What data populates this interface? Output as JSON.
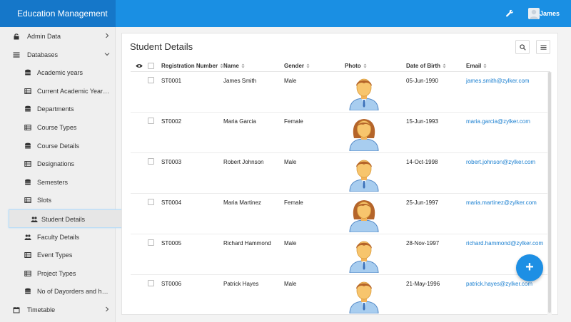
{
  "app": {
    "title": "Education Management",
    "user": "James"
  },
  "sidebar": {
    "items": [
      {
        "label": "Admin Data",
        "icon": "lock-icon",
        "level": 0,
        "chevron": "right"
      },
      {
        "label": "Databases",
        "icon": "list-icon",
        "level": 0,
        "chevron": "down"
      },
      {
        "label": "Academic years",
        "icon": "database-icon",
        "level": 1
      },
      {
        "label": "Current Academic Year and Semester",
        "icon": "table-icon",
        "level": 1
      },
      {
        "label": "Departments",
        "icon": "database-icon",
        "level": 1
      },
      {
        "label": "Course Types",
        "icon": "table-icon",
        "level": 1
      },
      {
        "label": "Course Details",
        "icon": "database-icon",
        "level": 1
      },
      {
        "label": "Designations",
        "icon": "table-icon",
        "level": 1
      },
      {
        "label": "Semesters",
        "icon": "database-icon",
        "level": 1
      },
      {
        "label": "Slots",
        "icon": "table-icon",
        "level": 1
      },
      {
        "label": "Student Details",
        "icon": "users-icon",
        "level": 1,
        "active": true
      },
      {
        "label": "Faculty Details",
        "icon": "users-icon",
        "level": 1
      },
      {
        "label": "Event Types",
        "icon": "table-icon",
        "level": 1
      },
      {
        "label": "Project Types",
        "icon": "table-icon",
        "level": 1
      },
      {
        "label": "No of Dayorders and hours",
        "icon": "database-icon",
        "level": 1
      },
      {
        "label": "Timetable",
        "icon": "calendar-icon",
        "level": 0,
        "chevron": "right"
      }
    ]
  },
  "main": {
    "title": "Student Details",
    "columns": [
      "Registration Number",
      "Name",
      "Gender",
      "Photo",
      "Date of Birth",
      "Email"
    ],
    "rows": [
      {
        "reg": "ST0001",
        "name": "James Smith",
        "gender": "Male",
        "dob": "05-Jun-1990",
        "email": "james.smith@zylker.com"
      },
      {
        "reg": "ST0002",
        "name": "Maria Garcia",
        "gender": "Female",
        "dob": "15-Jun-1993",
        "email": "maria.garcia@zylker.com"
      },
      {
        "reg": "ST0003",
        "name": "Robert Johnson",
        "gender": "Male",
        "dob": "14-Oct-1998",
        "email": "robert.johnson@zylker.com"
      },
      {
        "reg": "ST0004",
        "name": "Maria Martinez",
        "gender": "Female",
        "dob": "25-Jun-1997",
        "email": "maria.martinez@zylker.com"
      },
      {
        "reg": "ST0005",
        "name": "Richard Hammond",
        "gender": "Male",
        "dob": "28-Nov-1997",
        "email": "richard.hammond@zylker.com"
      },
      {
        "reg": "ST0006",
        "name": "Patrick Hayes",
        "gender": "Male",
        "dob": "21-May-1996",
        "email": "patrick.hayes@zylker.com"
      }
    ]
  },
  "fab": {
    "label": "+"
  },
  "colors": {
    "header": "#1a8fe3",
    "brand": "#1577c9",
    "link": "#1a7fd0",
    "fab": "#1d8fe4"
  }
}
